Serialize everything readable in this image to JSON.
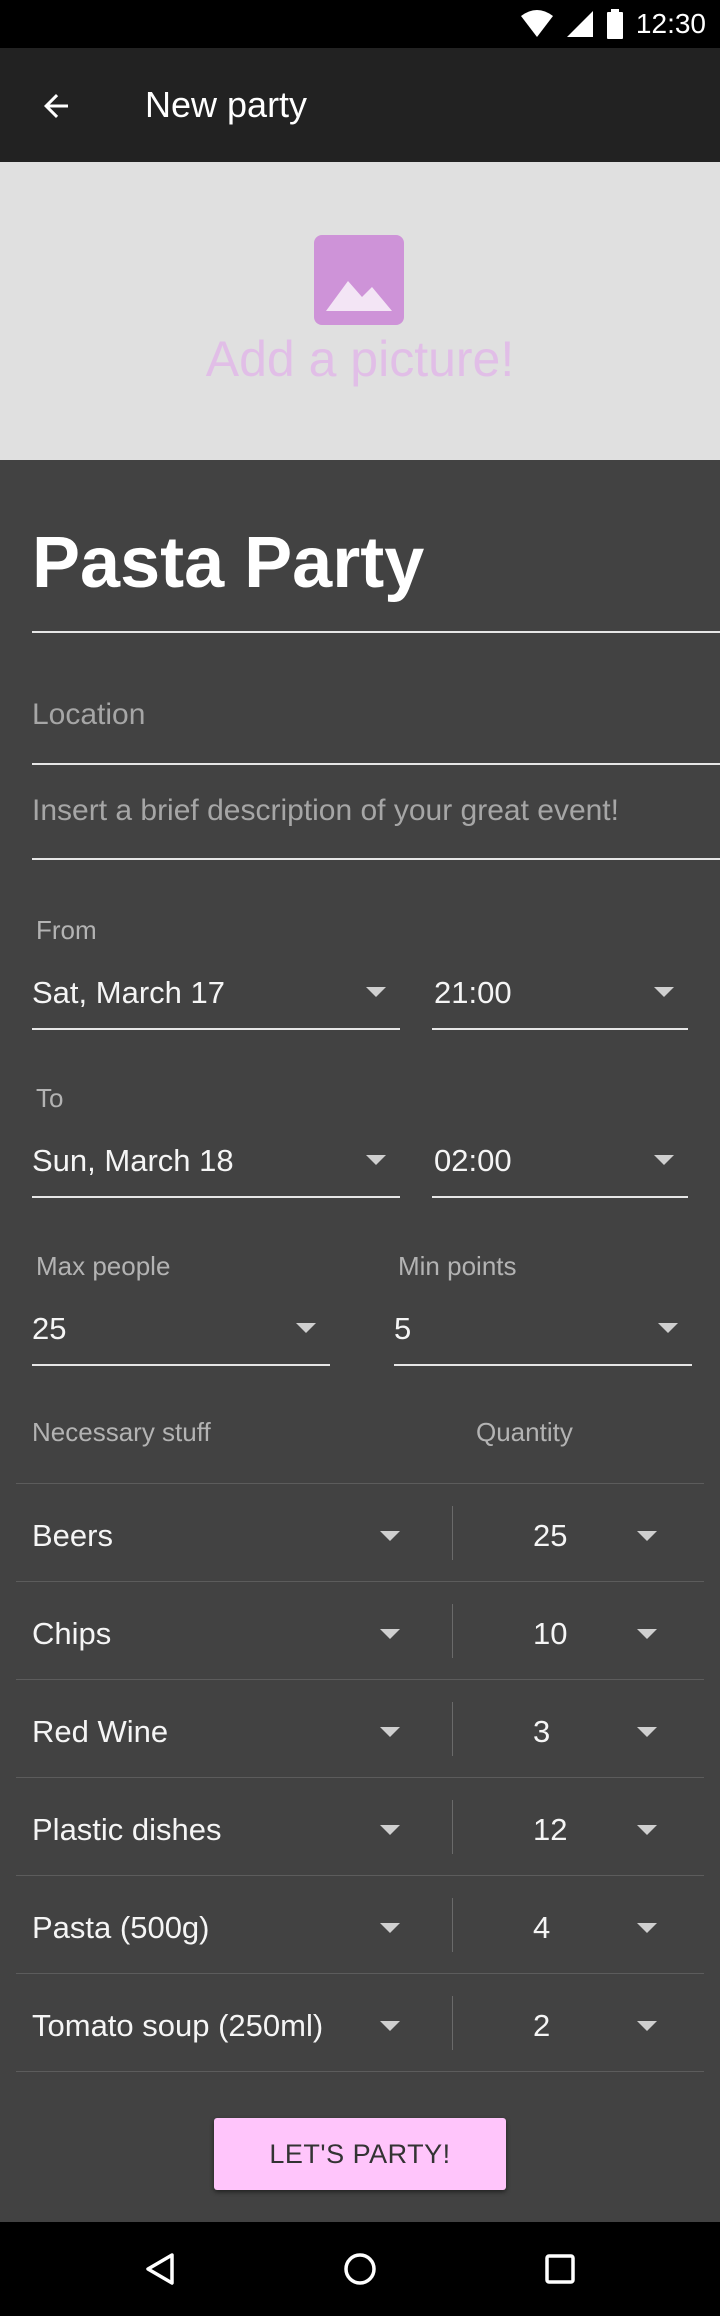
{
  "status_bar": {
    "time": "12:30",
    "icons": [
      "wifi-icon",
      "signal-icon",
      "battery-icon"
    ]
  },
  "app_bar": {
    "title": "New party",
    "back_icon": "arrow-back-icon"
  },
  "picture": {
    "label": "Add a picture!",
    "icon": "image-icon"
  },
  "form": {
    "title_value": "Pasta Party",
    "location_placeholder": "Location",
    "description_placeholder": "Insert a brief description of your great event!",
    "from": {
      "label": "From",
      "date": "Sat, March 17",
      "time": "21:00"
    },
    "to": {
      "label": "To",
      "date": "Sun, March 18",
      "time": "02:00"
    },
    "max_people": {
      "label": "Max people",
      "value": "25"
    },
    "min_points": {
      "label": "Min points",
      "value": "5"
    },
    "stuff": {
      "header_item": "Necessary stuff",
      "header_quantity": "Quantity",
      "items": [
        {
          "name": "Beers",
          "quantity": "25"
        },
        {
          "name": "Chips",
          "quantity": "10"
        },
        {
          "name": "Red Wine",
          "quantity": "3"
        },
        {
          "name": "Plastic dishes",
          "quantity": "12"
        },
        {
          "name": "Pasta (500g)",
          "quantity": "4"
        },
        {
          "name": "Tomato soup (250ml)",
          "quantity": "2"
        }
      ]
    },
    "submit_label": "LET'S PARTY!"
  },
  "colors": {
    "accent": "#ce93d8",
    "button": "#ffc5fb",
    "background": "#424242",
    "app_bar": "#222222"
  }
}
